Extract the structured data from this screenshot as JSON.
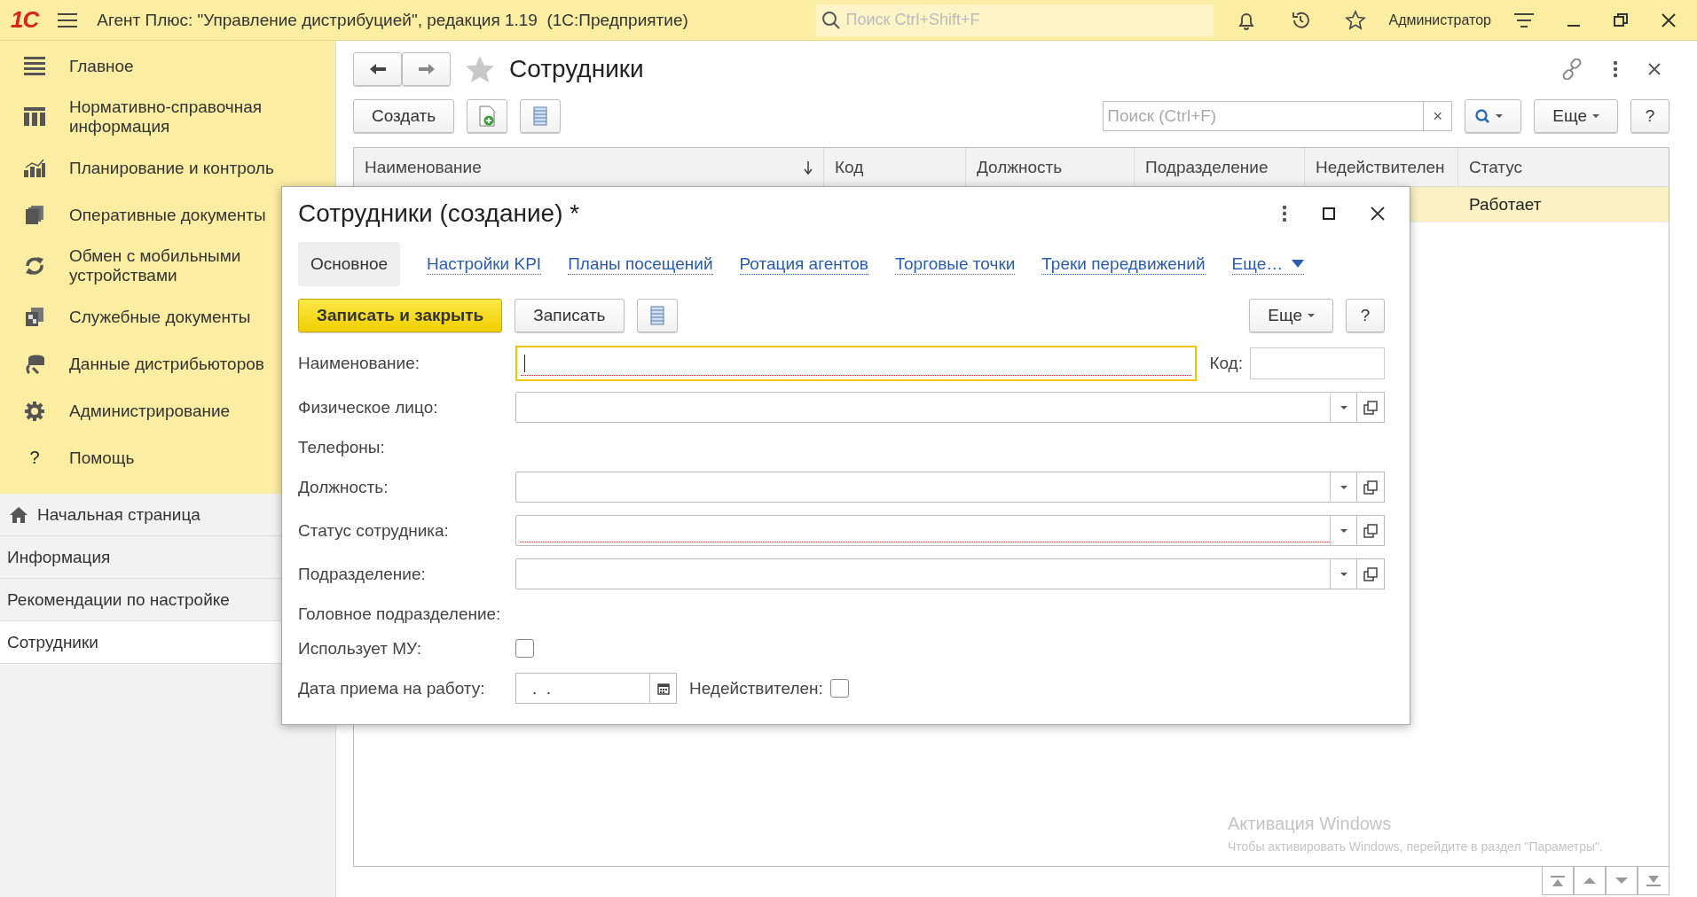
{
  "app_bar": {
    "logo": "1С",
    "title": "Агент Плюс: \"Управление дистрибуцией\", редакция 1.19  (1С:Предприятие)",
    "search": {
      "placeholder": "Поиск Ctrl+Shift+F"
    },
    "user": "Администратор"
  },
  "sidebar": {
    "sections": [
      {
        "label": "Главное"
      },
      {
        "label": "Нормативно-справочная информация"
      },
      {
        "label": "Планирование и контроль"
      },
      {
        "label": "Оперативные документы"
      },
      {
        "label": "Обмен с мобильными устройствами"
      },
      {
        "label": "Служебные документы"
      },
      {
        "label": "Данные дистрибьюторов"
      },
      {
        "label": "Администрирование"
      },
      {
        "label": "Помощь",
        "glyph": "?"
      }
    ],
    "open_pages": [
      {
        "label": "Начальная страница",
        "home": true,
        "selected": false
      },
      {
        "label": "Информация",
        "home": false,
        "selected": false
      },
      {
        "label": "Рекомендации по настройке",
        "home": false,
        "selected": false
      },
      {
        "label": "Сотрудники",
        "home": false,
        "selected": true
      }
    ]
  },
  "list": {
    "title": "Сотрудники",
    "toolbar": {
      "create": "Создать",
      "search": {
        "placeholder": "Поиск (Ctrl+F)"
      },
      "clear": "×",
      "more": "Еще",
      "help": "?"
    },
    "columns": [
      {
        "label": "Наименование",
        "sorted": true
      },
      {
        "label": "Код",
        "sorted": false
      },
      {
        "label": "Должность",
        "sorted": false
      },
      {
        "label": "Подразделение",
        "sorted": false
      },
      {
        "label": "Недействителен",
        "sorted": false
      },
      {
        "label": "Статус",
        "sorted": false
      }
    ],
    "rows": [
      {
        "status": "Работает",
        "selected": true
      }
    ]
  },
  "dialog": {
    "title": "Сотрудники (создание) *",
    "tabs": [
      {
        "label": "Основное",
        "selected": true
      },
      {
        "label": "Настройки KPI",
        "selected": false
      },
      {
        "label": "Планы посещений",
        "selected": false
      },
      {
        "label": "Ротация агентов",
        "selected": false
      },
      {
        "label": "Торговые точки",
        "selected": false
      },
      {
        "label": "Треки передвижений",
        "selected": false
      },
      {
        "label": "Еще…",
        "selected": false
      }
    ],
    "toolbar": {
      "save_close": "Записать и закрыть",
      "save": "Записать",
      "more": "Еще",
      "help": "?"
    },
    "fields": [
      {
        "kind": "text",
        "label": "Наименование:",
        "focused": true,
        "required": true,
        "code_label": "Код:"
      },
      {
        "kind": "select",
        "label": "Физическое лицо:",
        "required": false
      },
      {
        "kind": "label",
        "label": "Телефоны:"
      },
      {
        "kind": "select",
        "label": "Должность:",
        "required": false
      },
      {
        "kind": "select",
        "label": "Статус сотрудника:",
        "required": true
      },
      {
        "kind": "select",
        "label": "Подразделение:",
        "required": false
      },
      {
        "kind": "label",
        "label": "Головное подразделение:"
      },
      {
        "kind": "checkbox",
        "label": "Использует МУ:",
        "checked": false
      },
      {
        "kind": "date",
        "label": "Дата приема на работу:",
        "value": ".  .",
        "flag_label": "Недействителен:",
        "flag_checked": false
      }
    ]
  },
  "windows_notice": {
    "title": "Активация Windows",
    "text": "Чтобы активировать Windows, перейдите в раздел \"Параметры\"."
  }
}
